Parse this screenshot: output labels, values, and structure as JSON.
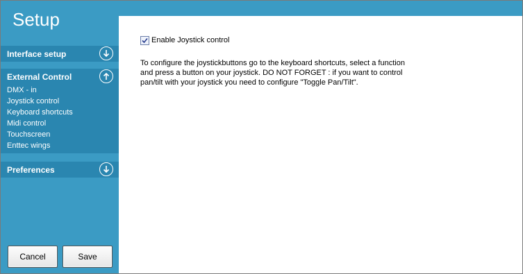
{
  "sidebar": {
    "title": "Setup",
    "sections": {
      "interface": {
        "label": "Interface setup",
        "icon": "arrow-down-circle-icon"
      },
      "external": {
        "label": "External Control",
        "icon": "arrow-up-circle-icon",
        "items": [
          "DMX - in",
          "Joystick control",
          "Keyboard shortcuts",
          "Midi control",
          "Touchscreen",
          "Enttec wings"
        ]
      },
      "preferences": {
        "label": "Preferences",
        "icon": "arrow-down-circle-icon"
      }
    },
    "cancel_label": "Cancel",
    "save_label": "Save"
  },
  "content": {
    "checkbox_label": "Enable Joystick control",
    "checkbox_checked": true,
    "description_lines": [
      "To configure the joystickbuttons go to the keyboard shortcuts, select a function",
      "and press a button on your joystick. DO NOT FORGET : if you want to control",
      "pan/tilt with your joystick you need to configure \"Toggle Pan/Tilt\"."
    ]
  },
  "colors": {
    "sidebar_bg": "#3b9bc4",
    "section_bg": "#2a86b0",
    "text_light": "#ffffff"
  }
}
